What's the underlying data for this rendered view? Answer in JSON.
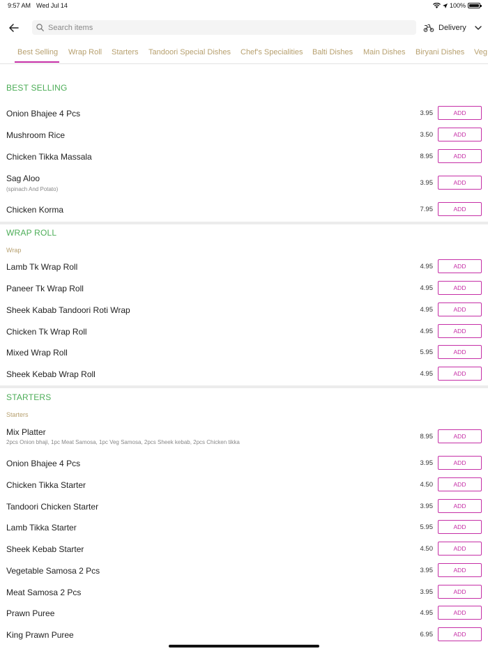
{
  "status_bar": {
    "time": "9:57 AM",
    "date": "Wed Jul 14",
    "battery": "100%"
  },
  "header": {
    "search_placeholder": "Search items",
    "delivery_label": "Delivery"
  },
  "tabs": [
    {
      "label": "Best Selling",
      "active": true
    },
    {
      "label": "Wrap Roll"
    },
    {
      "label": "Starters"
    },
    {
      "label": "Tandoori Special Dishes"
    },
    {
      "label": "Chef's Specialities"
    },
    {
      "label": "Balti Dishes"
    },
    {
      "label": "Main Dishes"
    },
    {
      "label": "Biryani Dishes"
    },
    {
      "label": "Veg"
    }
  ],
  "add_label": "ADD",
  "sections": {
    "best_selling": {
      "title": "BEST SELLING",
      "items": [
        {
          "name": "Onion Bhajee 4 Pcs",
          "price": "3.95"
        },
        {
          "name": "Mushroom Rice",
          "price": "3.50"
        },
        {
          "name": "Chicken Tikka Massala",
          "price": "8.95"
        },
        {
          "name": "Sag Aloo",
          "desc": "(spinach And Potato)",
          "price": "3.95"
        },
        {
          "name": "Chicken Korma",
          "price": "7.95"
        }
      ]
    },
    "wrap_roll": {
      "title": "WRAP ROLL",
      "subtitle": "Wrap",
      "items": [
        {
          "name": "Lamb Tk Wrap Roll",
          "price": "4.95"
        },
        {
          "name": "Paneer Tk Wrap Roll",
          "price": "4.95"
        },
        {
          "name": "Sheek Kabab Tandoori Roti Wrap",
          "price": "4.95"
        },
        {
          "name": "Chicken Tk Wrap Roll",
          "price": "4.95"
        },
        {
          "name": "Mixed Wrap Roll",
          "price": "5.95"
        },
        {
          "name": "Sheek Kebab Wrap Roll",
          "price": "4.95"
        }
      ]
    },
    "starters": {
      "title": "STARTERS",
      "subtitle": "Starters",
      "items": [
        {
          "name": "Mix Platter",
          "desc": "2pcs Onion bhaji, 1pc Meat Samosa, 1pc Veg Samosa, 2pcs Sheek kebab, 2pcs Chicken tikka",
          "price": "8.95"
        },
        {
          "name": "Onion Bhajee 4 Pcs",
          "price": "3.95"
        },
        {
          "name": "Chicken Tikka Starter",
          "price": "4.50"
        },
        {
          "name": "Tandoori Chicken Starter",
          "price": "3.95"
        },
        {
          "name": "Lamb Tikka Starter",
          "price": "5.95"
        },
        {
          "name": "Sheek Kebab Starter",
          "price": "4.50"
        },
        {
          "name": "Vegetable Samosa 2 Pcs",
          "price": "3.95"
        },
        {
          "name": "Meat Samosa 2 Pcs",
          "price": "3.95"
        },
        {
          "name": "Prawn Puree",
          "price": "4.95"
        },
        {
          "name": "King Prawn Puree",
          "price": "6.95"
        }
      ]
    }
  },
  "colors": {
    "accent": "#c52ea6",
    "section_title": "#4cad57",
    "tab_text": "#b7a06f"
  }
}
